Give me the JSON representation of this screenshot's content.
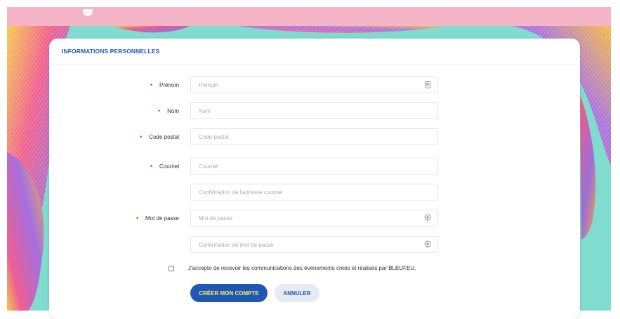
{
  "form": {
    "section_title": "INFORMATIONS PERSONNELLES",
    "required_marker": "•",
    "fields": {
      "first_name": {
        "label": "Prénom",
        "placeholder": "Prénom"
      },
      "last_name": {
        "label": "Nom",
        "placeholder": "Nom"
      },
      "postal_code": {
        "label": "Code postal",
        "placeholder": "Code postal"
      },
      "email": {
        "label": "Courriel",
        "placeholder": "Courriel"
      },
      "email_confirm": {
        "placeholder": "Confirmation de l'adresse courriel"
      },
      "password": {
        "label": "Mot de passe",
        "placeholder": "Mot de passe"
      },
      "password_confirm": {
        "placeholder": "Confirmation de mot de passe"
      }
    },
    "consent_text": "J'accepte de recevoir les communications des événements créés et réalisés par BLEUFEU.",
    "consent_checked": false,
    "create_button": "CRÉER MON COMPTE",
    "cancel_button": "ANNULER"
  },
  "icons": {
    "first_name_field_icon": "contact-card-icon",
    "password_field_icon": "eye-icon",
    "password_confirm_field_icon": "eye-icon"
  },
  "colors": {
    "accent": "#1f57b8",
    "button_text": "#fff34d",
    "required": "#e0301e",
    "top_bar": "#f6b5c7",
    "background_teal": "#7fdccf"
  }
}
